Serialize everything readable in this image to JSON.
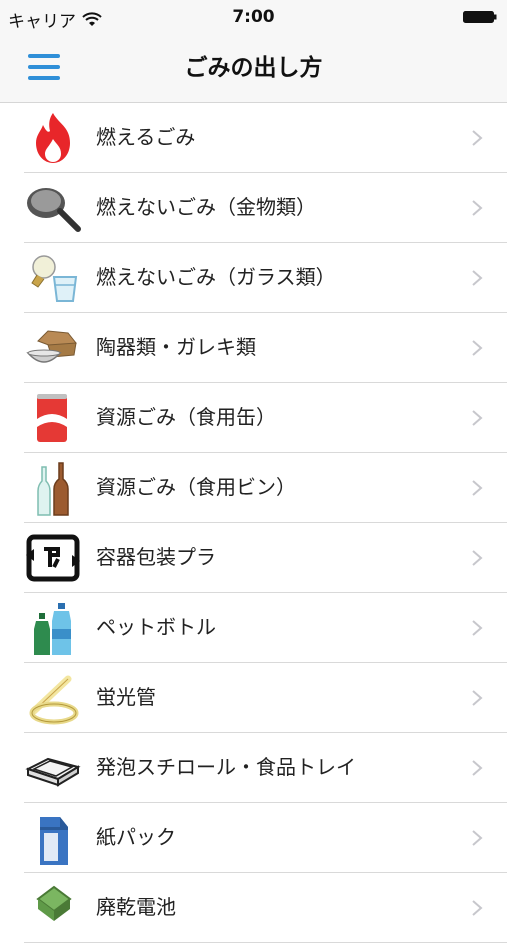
{
  "status": {
    "carrier": "キャリア",
    "time": "7:00"
  },
  "nav": {
    "title": "ごみの出し方"
  },
  "items": [
    {
      "label": "燃えるごみ",
      "icon": "flame-icon"
    },
    {
      "label": "燃えないごみ（金物類）",
      "icon": "frying-pan-icon"
    },
    {
      "label": "燃えないごみ（ガラス類）",
      "icon": "lightbulb-glass-icon"
    },
    {
      "label": "陶器類・ガレキ類",
      "icon": "ceramic-bowl-icon"
    },
    {
      "label": "資源ごみ（食用缶）",
      "icon": "can-icon"
    },
    {
      "label": "資源ごみ（食用ビン）",
      "icon": "bottles-icon"
    },
    {
      "label": "容器包装プラ",
      "icon": "pla-recycle-icon"
    },
    {
      "label": "ペットボトル",
      "icon": "pet-bottle-icon"
    },
    {
      "label": "蛍光管",
      "icon": "fluorescent-tube-icon"
    },
    {
      "label": "発泡スチロール・食品トレイ",
      "icon": "styrofoam-tray-icon"
    },
    {
      "label": "紙パック",
      "icon": "milk-carton-icon"
    },
    {
      "label": "廃乾電池",
      "icon": "battery-icon"
    }
  ]
}
